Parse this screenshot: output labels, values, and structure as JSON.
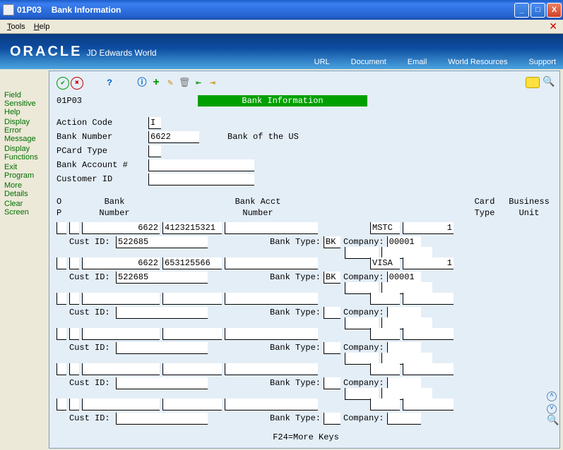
{
  "window": {
    "program": "01P03",
    "title": "Bank Information"
  },
  "menu": {
    "tools": "Tools",
    "help": "Help"
  },
  "brand": {
    "oracle": "ORACLE",
    "jde": "JD Edwards World"
  },
  "navlinks": {
    "url": "URL",
    "document": "Document",
    "email": "Email",
    "world": "World Resources",
    "support": "Support"
  },
  "sidebar": {
    "items": [
      "Field Sensitive Help",
      "Display Error Message",
      "Display Functions",
      "Exit Program",
      "More Details",
      "Clear Screen"
    ]
  },
  "header": {
    "program_id": "01P03",
    "banner": "Bank Information",
    "labels": {
      "action_code": "Action Code",
      "bank_number": "Bank Number",
      "pcard_type": "PCard Type",
      "bank_acct": "Bank Account #",
      "customer_id": "Customer ID"
    },
    "values": {
      "action_code": "I",
      "bank_number": "6622",
      "bank_name": "Bank of the US",
      "pcard_type": "",
      "bank_acct": "",
      "customer_id": ""
    }
  },
  "grid": {
    "head1": {
      "o": "O",
      "bank": "Bank",
      "acct": "Bank Acct",
      "card": "Card",
      "bu": "Business"
    },
    "head2": {
      "p": "P",
      "number1": "Number",
      "number2": "Number",
      "type": "Type",
      "unit": "Unit"
    },
    "sublabels": {
      "cust_id": "Cust ID:",
      "bank_type": "Bank Type:",
      "company": "Company:"
    },
    "rows": [
      {
        "op": "",
        "x": "",
        "bank_no": "6622",
        "acct_no": "4123215321",
        "blank": "",
        "card": "MSTC",
        "bu": "1",
        "cust_id": "522685",
        "bank_type": "BK",
        "company": "00001"
      },
      {
        "op": "",
        "x": "",
        "bank_no": "6622",
        "acct_no": "653125566",
        "blank": "",
        "card": "VISA",
        "bu": "1",
        "cust_id": "522685",
        "bank_type": "BK",
        "company": "00001"
      },
      {
        "op": "",
        "x": "",
        "bank_no": "",
        "acct_no": "",
        "blank": "",
        "card": "",
        "bu": "",
        "cust_id": "",
        "bank_type": "",
        "company": ""
      },
      {
        "op": "",
        "x": "",
        "bank_no": "",
        "acct_no": "",
        "blank": "",
        "card": "",
        "bu": "",
        "cust_id": "",
        "bank_type": "",
        "company": ""
      },
      {
        "op": "",
        "x": "",
        "bank_no": "",
        "acct_no": "",
        "blank": "",
        "card": "",
        "bu": "",
        "cust_id": "",
        "bank_type": "",
        "company": ""
      },
      {
        "op": "",
        "x": "",
        "bank_no": "",
        "acct_no": "",
        "blank": "",
        "card": "",
        "bu": "",
        "cust_id": "",
        "bank_type": "",
        "company": ""
      }
    ]
  },
  "footer": {
    "hint": "F24=More Keys"
  }
}
